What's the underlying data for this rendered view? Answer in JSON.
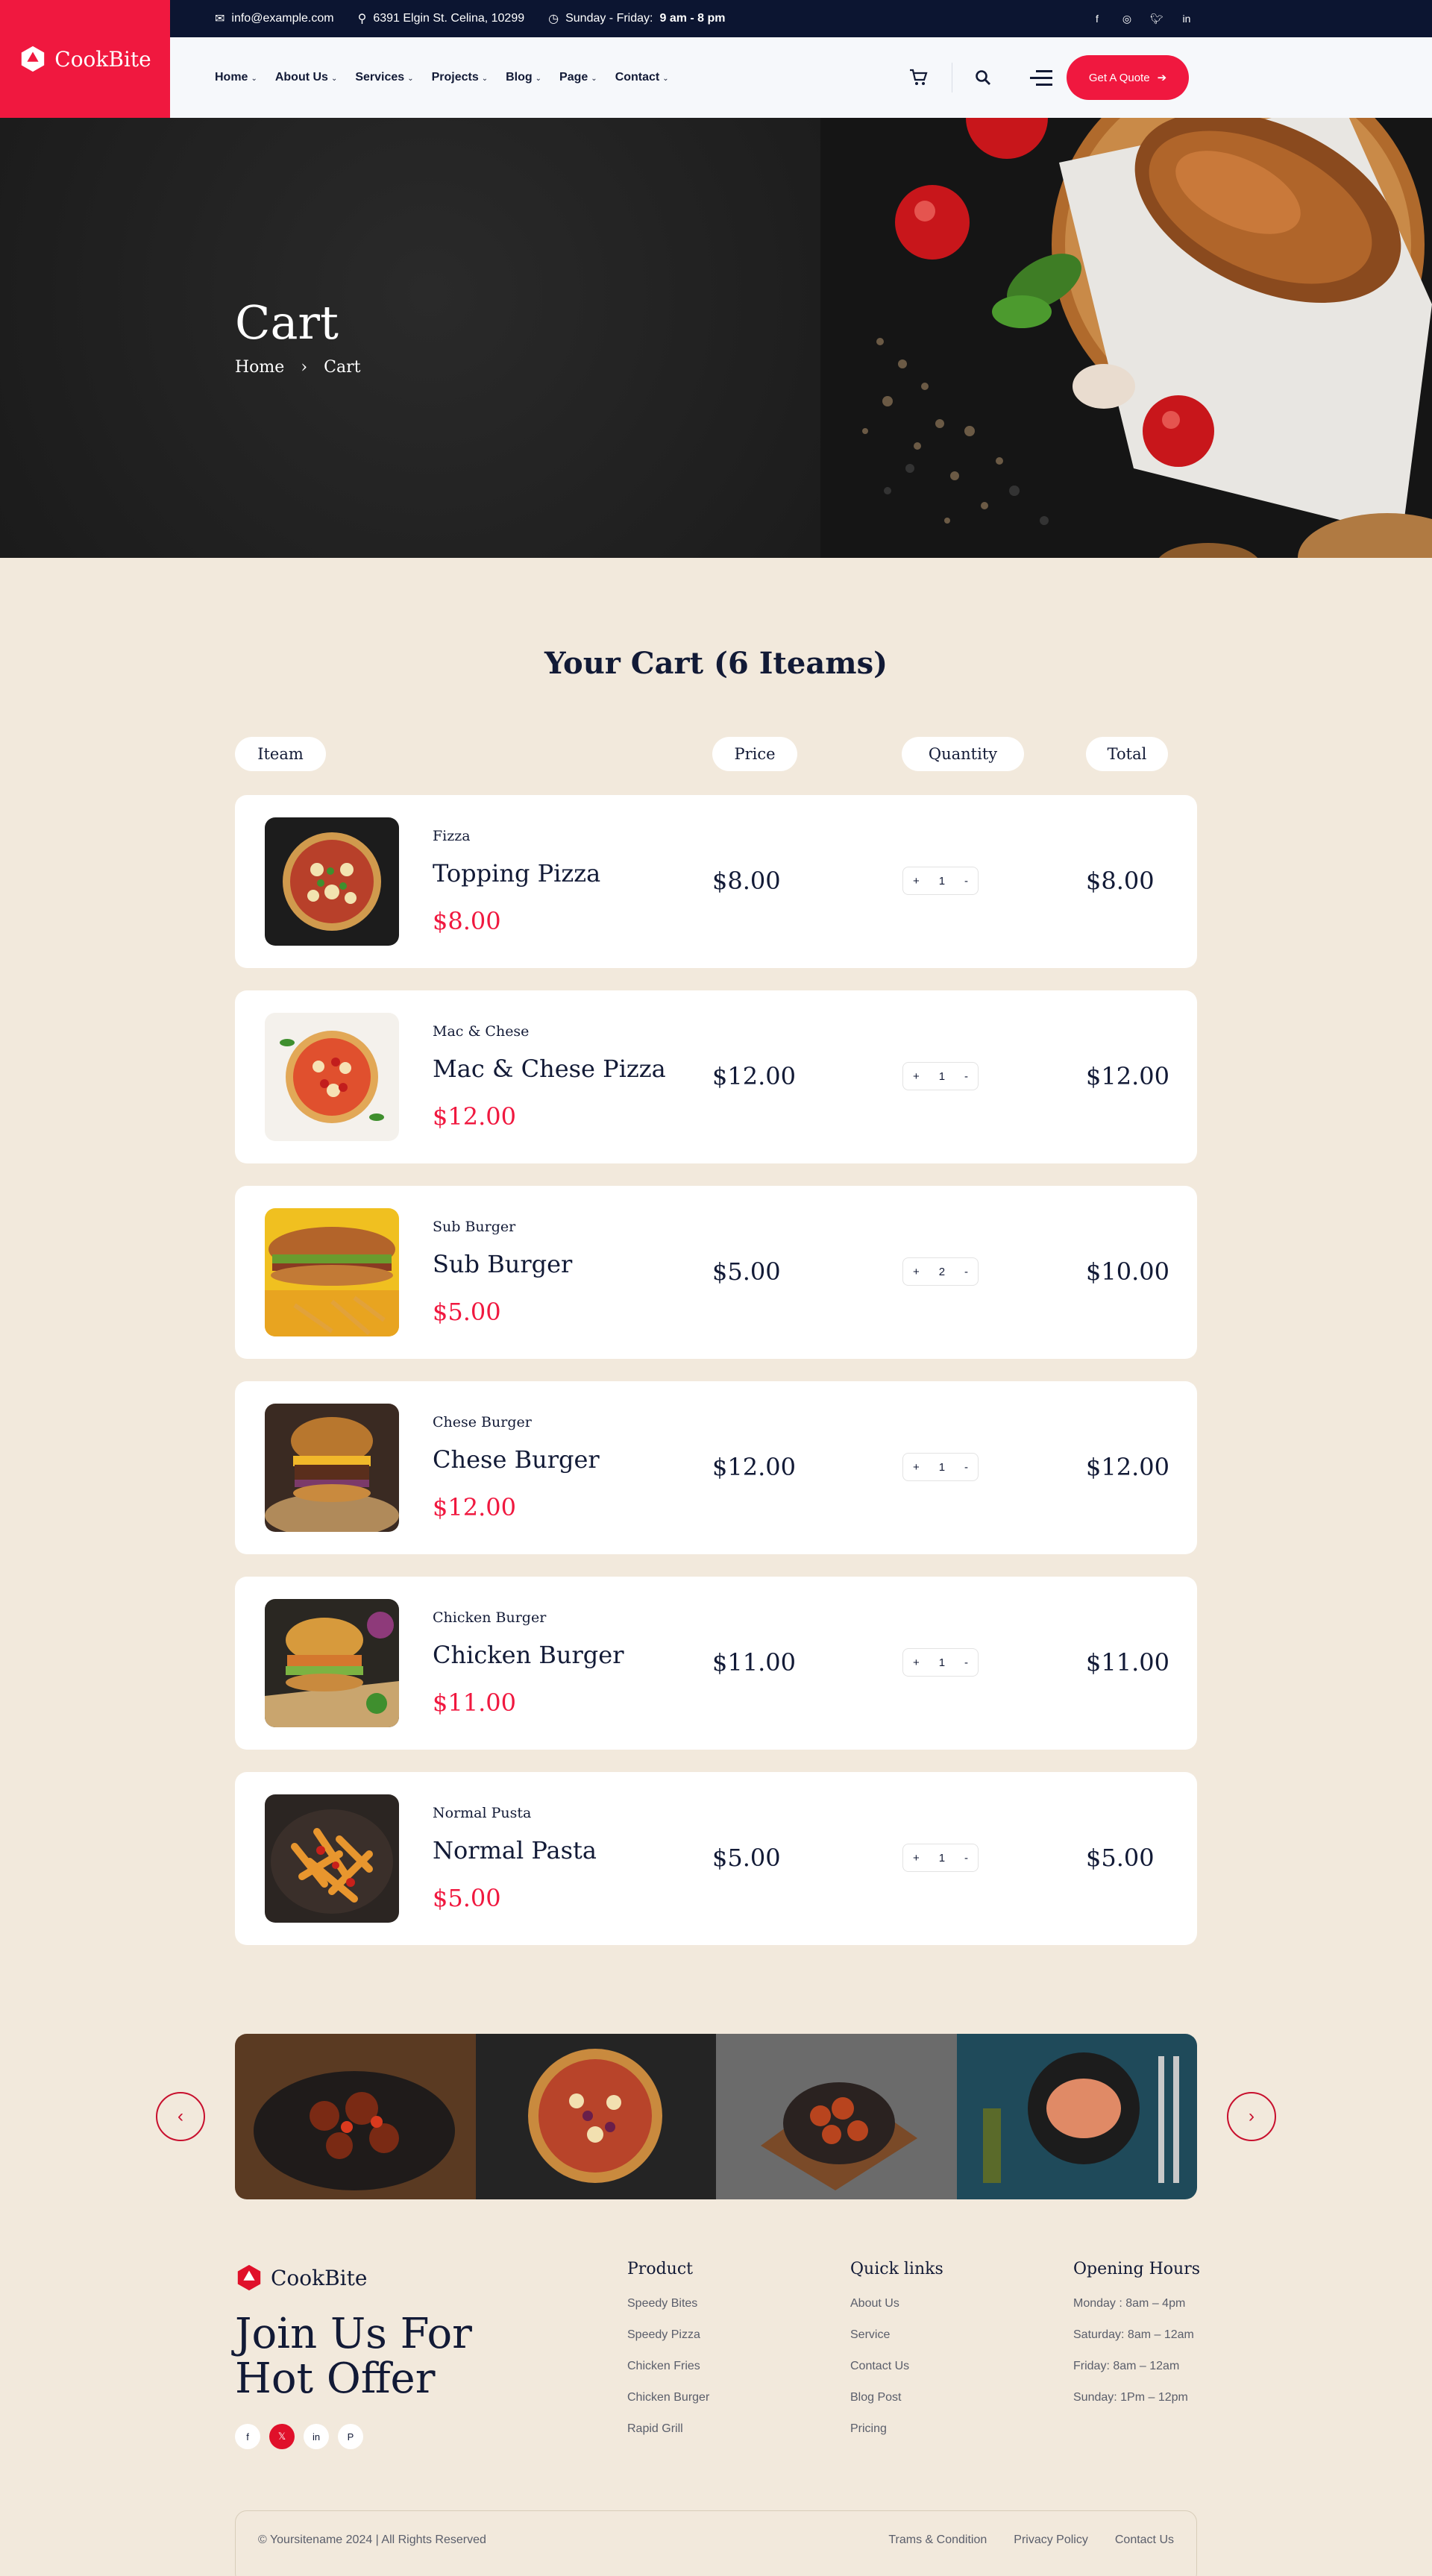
{
  "brand": {
    "name": "CookBite"
  },
  "topbar": {
    "email": "info@example.com",
    "address": "6391 Elgin St. Celina, 10299",
    "hours_label": "Sunday - Friday:",
    "hours_value": "9 am - 8 pm",
    "socials": [
      "facebook-icon",
      "instagram-icon",
      "twitter-icon",
      "linkedin-icon"
    ]
  },
  "nav": {
    "items": [
      "Home",
      "About Us",
      "Services",
      "Projects",
      "Blog",
      "Page",
      "Contact"
    ],
    "quote_button": "Get A Quote"
  },
  "hero": {
    "title": "Cart",
    "breadcrumb": [
      "Home",
      "Cart"
    ]
  },
  "cart": {
    "heading": "Your Cart (6 Iteams)",
    "columns": {
      "item": "Iteam",
      "price": "Price",
      "quantity": "Quantity",
      "total": "Total"
    },
    "items": [
      {
        "category": "Fizza",
        "name": "Topping Pizza",
        "unit_price": "$8.00",
        "price": "$8.00",
        "qty": "1",
        "total": "$8.00"
      },
      {
        "category": "Mac & Chese",
        "name": "Mac & Chese Pizza",
        "unit_price": "$12.00",
        "price": "$12.00",
        "qty": "1",
        "total": "$12.00"
      },
      {
        "category": "Sub Burger",
        "name": "Sub Burger",
        "unit_price": "$5.00",
        "price": "$5.00",
        "qty": "2",
        "total": "$10.00"
      },
      {
        "category": "Chese Burger",
        "name": "Chese Burger",
        "unit_price": "$12.00",
        "price": "$12.00",
        "qty": "1",
        "total": "$12.00"
      },
      {
        "category": "Chicken Burger",
        "name": "Chicken Burger",
        "unit_price": "$11.00",
        "price": "$11.00",
        "qty": "1",
        "total": "$11.00"
      },
      {
        "category": "Normal Pusta",
        "name": "Normal Pasta",
        "unit_price": "$5.00",
        "price": "$5.00",
        "qty": "1",
        "total": "$5.00"
      }
    ],
    "qty_plus": "+",
    "qty_minus": "-"
  },
  "footer": {
    "join": "Join Us For Hot Offer",
    "product": {
      "title": "Product",
      "links": [
        "Speedy Bites",
        "Speedy Pizza",
        "Chicken Fries",
        "Chicken Burger",
        "Rapid Grill"
      ]
    },
    "quick": {
      "title": "Quick links",
      "links": [
        "About Us",
        "Service",
        "Contact Us",
        "Blog Post",
        "Pricing"
      ]
    },
    "hours": {
      "title": "Opening Hours",
      "lines": [
        "Monday : 8am – 4pm",
        "Saturday: 8am – 12am",
        "Friday: 8am – 12am",
        "Sunday: 1Pm – 12pm"
      ]
    },
    "copyright": "© Yoursitename  2024 | All Rights Reserved",
    "bottom_links": [
      "Trams & Condition",
      "Privacy Policy",
      "Contact Us"
    ]
  },
  "colors": {
    "accent": "#f0183f",
    "navy": "#0c1531",
    "cream": "#f2e9dc"
  }
}
